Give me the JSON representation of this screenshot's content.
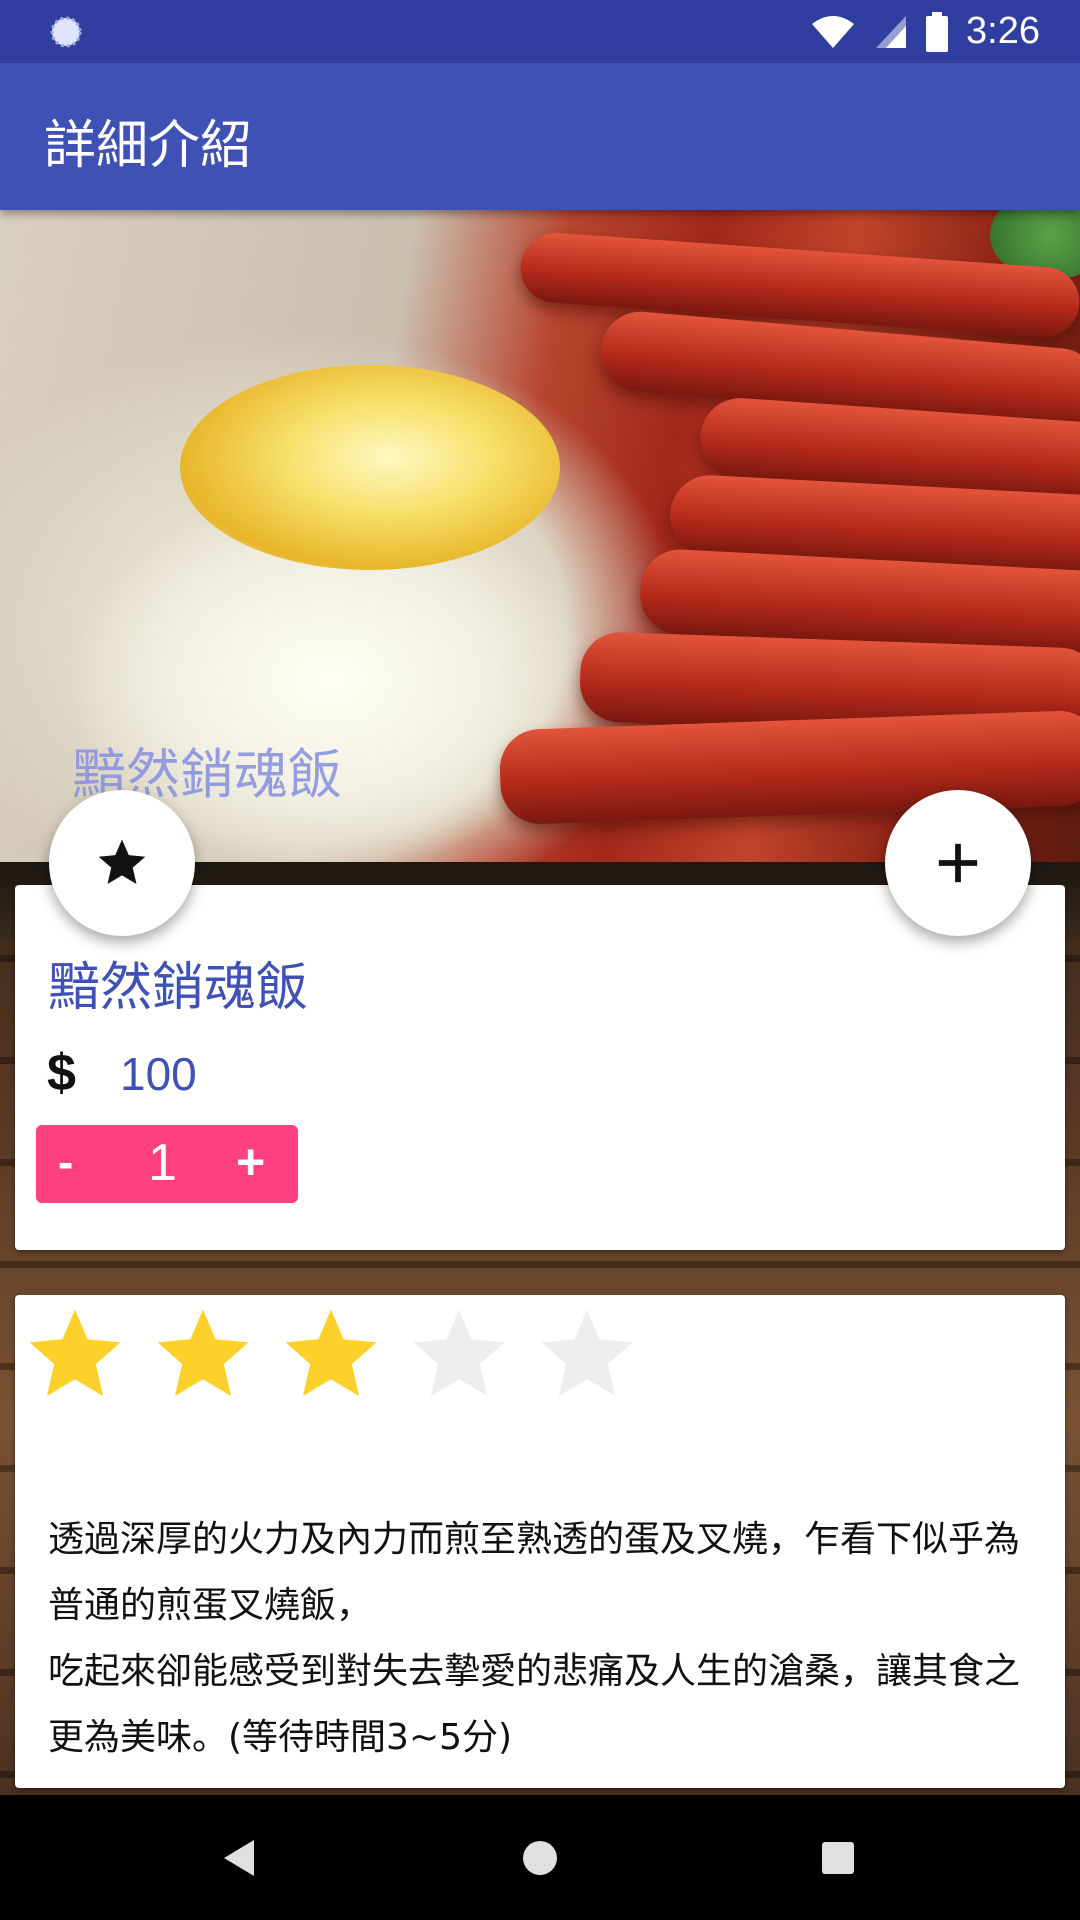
{
  "status_bar": {
    "time": "3:26",
    "icons": [
      "sync-icon",
      "wifi-icon",
      "signal-icon",
      "battery-icon"
    ]
  },
  "app_bar": {
    "title": "詳細介紹"
  },
  "hero": {
    "overlay_title": "黯然銷魂飯",
    "image": "egg-and-char-siu-rice-photo"
  },
  "fabs": {
    "favorite_icon": "star-icon",
    "add_icon": "plus-icon"
  },
  "item": {
    "name": "黯然銷魂飯",
    "currency_symbol": "$",
    "price": "100",
    "quantity": {
      "minus_label": "-",
      "value": "1",
      "plus_label": "+"
    }
  },
  "rating": {
    "value": 3,
    "max": 5,
    "filled_color": "#fdd02a",
    "empty_color": "#eeeeee"
  },
  "description": "透過深厚的火力及內力而煎至熟透的蛋及叉燒，乍看下似乎為普通的煎蛋叉燒飯，\n吃起來卻能感受到對失去摯愛的悲痛及人生的滄桑，讓其食之更為美味。(等待時間3~5分)",
  "colors": {
    "primary": "#3f51b5",
    "primary_dark": "#303f9f",
    "accent": "#ff4081"
  },
  "nav_bar": {
    "buttons": [
      "back-icon",
      "home-icon",
      "recents-icon"
    ]
  }
}
